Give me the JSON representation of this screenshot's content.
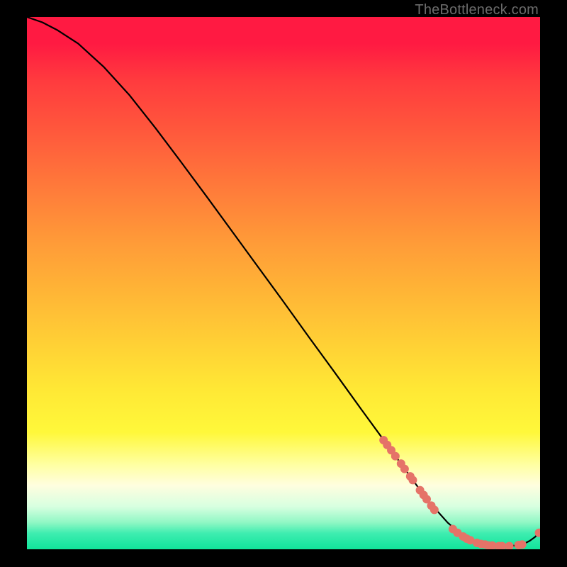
{
  "watermark": "TheBottleneck.com",
  "chart_data": {
    "type": "line",
    "title": "",
    "xlabel": "",
    "ylabel": "",
    "xlim": [
      0,
      100
    ],
    "ylim": [
      0,
      100
    ],
    "grid": false,
    "legend": false,
    "series": [
      {
        "name": "bottleneck-curve",
        "color": "#000000",
        "x": [
          0,
          3,
          6,
          10,
          15,
          20,
          25,
          30,
          35,
          40,
          45,
          50,
          55,
          60,
          65,
          70,
          74,
          78,
          82,
          85,
          88,
          90,
          92,
          94,
          96,
          97,
          98,
          99,
          100
        ],
        "y": [
          100,
          99,
          97.5,
          95,
          90.6,
          85.3,
          79.2,
          72.8,
          66.3,
          59.7,
          53.1,
          46.5,
          39.8,
          33.2,
          26.5,
          19.9,
          14.6,
          9.3,
          5.0,
          2.5,
          1.1,
          0.7,
          0.6,
          0.6,
          0.8,
          1.1,
          1.6,
          2.3,
          3.2
        ]
      }
    ],
    "highlight_points": {
      "name": "highlighted-range",
      "color": "#e57368",
      "radius": 6,
      "points": [
        {
          "x": 69.5,
          "y": 20.5
        },
        {
          "x": 70.2,
          "y": 19.6
        },
        {
          "x": 71.0,
          "y": 18.6
        },
        {
          "x": 71.8,
          "y": 17.5
        },
        {
          "x": 72.9,
          "y": 16.1
        },
        {
          "x": 73.6,
          "y": 15.1
        },
        {
          "x": 74.7,
          "y": 13.7
        },
        {
          "x": 75.2,
          "y": 13.0
        },
        {
          "x": 76.6,
          "y": 11.1
        },
        {
          "x": 77.3,
          "y": 10.2
        },
        {
          "x": 77.9,
          "y": 9.4
        },
        {
          "x": 78.8,
          "y": 8.2
        },
        {
          "x": 79.4,
          "y": 7.4
        },
        {
          "x": 83.0,
          "y": 3.8
        },
        {
          "x": 83.9,
          "y": 3.1
        },
        {
          "x": 85.0,
          "y": 2.4
        },
        {
          "x": 85.7,
          "y": 2.0
        },
        {
          "x": 86.4,
          "y": 1.7
        },
        {
          "x": 87.7,
          "y": 1.2
        },
        {
          "x": 88.5,
          "y": 1.0
        },
        {
          "x": 89.3,
          "y": 0.9
        },
        {
          "x": 90.0,
          "y": 0.7
        },
        {
          "x": 90.7,
          "y": 0.7
        },
        {
          "x": 92.0,
          "y": 0.6
        },
        {
          "x": 92.6,
          "y": 0.6
        },
        {
          "x": 94.0,
          "y": 0.6
        },
        {
          "x": 95.8,
          "y": 0.8
        },
        {
          "x": 96.5,
          "y": 0.9
        },
        {
          "x": 99.8,
          "y": 3.1
        }
      ]
    }
  }
}
